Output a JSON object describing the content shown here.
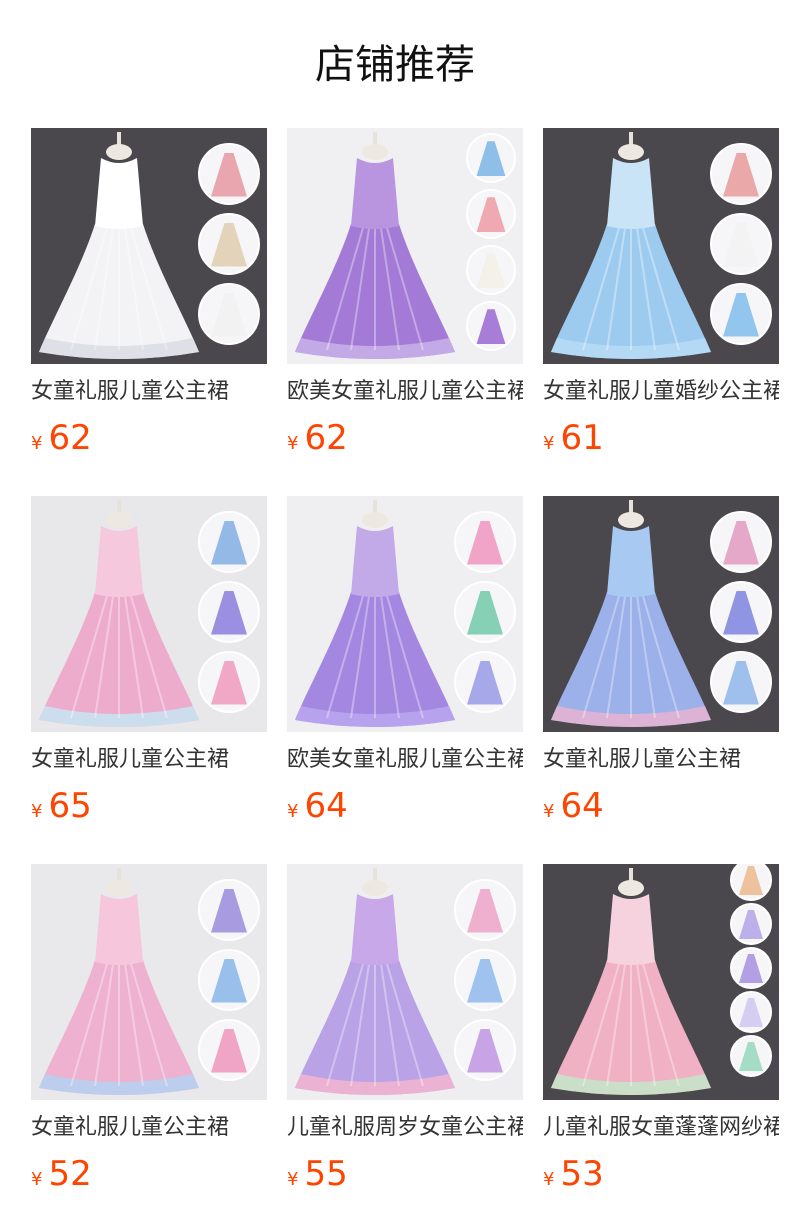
{
  "section_title": "店铺推荐",
  "currency_symbol": "¥",
  "colors": {
    "price": "#ff4400",
    "title": "#111111",
    "text": "#333333"
  },
  "products": [
    {
      "title": "女童礼服儿童公主裙",
      "price": "62",
      "bg": "#4a484c",
      "dress": "#f3f3f6",
      "bodice": "#ffffff",
      "hem": "#dcdde6",
      "swatches": [
        "#e9a6ae",
        "#e4d3bb",
        "#f2f2f2"
      ]
    },
    {
      "title": "欧美女童礼服儿童公主裙",
      "price": "62",
      "bg": "#f0eff1",
      "dress": "#a37ad6",
      "bodice": "#b995e0",
      "hem": "#c6aee8",
      "swatches": [
        "#8dbfe8",
        "#eeaab0",
        "#f3f1ea",
        "#a77dd8"
      ]
    },
    {
      "title": "女童礼服儿童婚纱公主裙",
      "price": "61",
      "bg": "#4a484c",
      "dress": "#9dcbf0",
      "bodice": "#c9e3f7",
      "hem": "#b7daf5",
      "swatches": [
        "#eba8a8",
        "#f3f3f3",
        "#92c6ee"
      ]
    },
    {
      "title": "女童礼服儿童公主裙",
      "price": "65",
      "bg": "#e8e7ea",
      "dress": "#eeaccd",
      "bodice": "#f5c8dd",
      "hem": "#c8e2f2",
      "swatches": [
        "#95b9e6",
        "#9a8fe0",
        "#f0a8c6"
      ]
    },
    {
      "title": "欧美女童礼服儿童公主裙",
      "price": "64",
      "bg": "#efeef1",
      "dress": "#a487e0",
      "bodice": "#c2aae9",
      "hem": "#b9a6ee",
      "swatches": [
        "#f1a4c8",
        "#86d0b5",
        "#a7a8ea"
      ]
    },
    {
      "title": "女童礼服儿童公主裙",
      "price": "64",
      "bg": "#4a484c",
      "dress": "#9cb0ea",
      "bodice": "#a8c9f2",
      "hem": "#e3b2d3",
      "swatches": [
        "#e5a8c9",
        "#8f95e3",
        "#9fc0ec"
      ]
    },
    {
      "title": "女童礼服儿童公主裙",
      "price": "52",
      "bg": "#e9e8eb",
      "dress": "#efb1d0",
      "bodice": "#f6c6dd",
      "hem": "#b6d0f0",
      "swatches": [
        "#a89be0",
        "#99c0ea",
        "#f0a4c6"
      ]
    },
    {
      "title": "儿童礼服周岁女童公主裙",
      "price": "55",
      "bg": "#eeedf0",
      "dress": "#b9a3e6",
      "bodice": "#c9a8ea",
      "hem": "#f1b4d0",
      "swatches": [
        "#eeb0ce",
        "#9fc3ee",
        "#c8a4e6"
      ]
    },
    {
      "title": "儿童礼服女童蓬蓬网纱裙",
      "price": "53",
      "bg": "#4a484c",
      "dress": "#f0b1c4",
      "bodice": "#f6d2df",
      "hem": "#c5e3c9",
      "swatches": [
        "#efc29e",
        "#bdb0ea",
        "#b39fe4",
        "#d6cdf3",
        "#a5dcc5"
      ]
    }
  ]
}
